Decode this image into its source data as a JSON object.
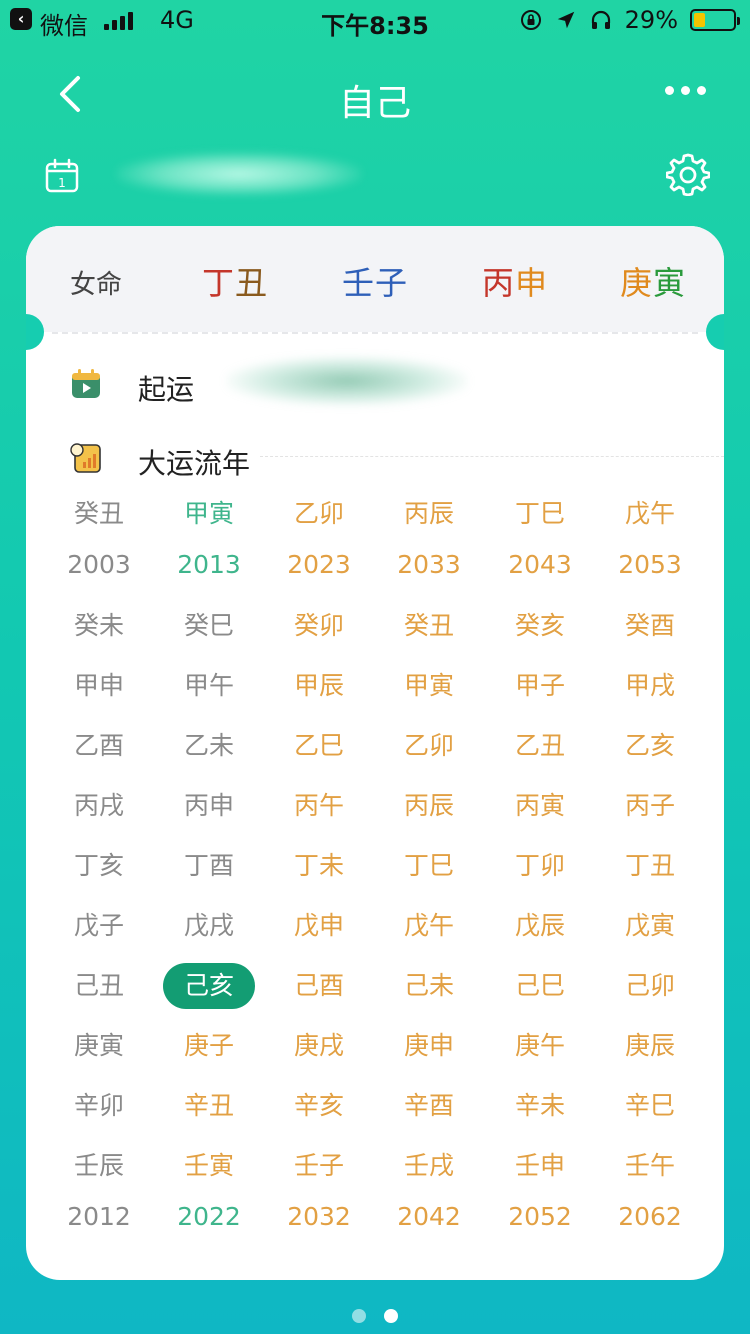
{
  "status_bar": {
    "app": "微信",
    "network": "4G",
    "time": "下午8:35",
    "battery": "29%",
    "battery_level": 0.29
  },
  "nav": {
    "title": "自己"
  },
  "header": {
    "gender": "女命",
    "pillars": [
      {
        "stem": "丁",
        "branch": "丑",
        "stem_color": "#c4362b",
        "branch_color": "#8a5a1e"
      },
      {
        "stem": "壬",
        "branch": "子",
        "stem_color": "#2e5fb8",
        "branch_color": "#2e5fb8"
      },
      {
        "stem": "丙",
        "branch": "申",
        "stem_color": "#c4362b",
        "branch_color": "#e08a1e"
      },
      {
        "stem": "庚",
        "branch": "寅",
        "stem_color": "#e08a1e",
        "branch_color": "#2a9a3c"
      }
    ]
  },
  "sections": {
    "qiyun_label": "起运",
    "dayun_label": "大运流年"
  },
  "dayun": {
    "columns": [
      {
        "pillar": "癸丑",
        "start_year": "2003",
        "end_year": "2012",
        "tone": "gray",
        "liunian": [
          {
            "text": "癸未",
            "tone": "gray"
          },
          {
            "text": "甲申",
            "tone": "gray"
          },
          {
            "text": "乙酉",
            "tone": "gray"
          },
          {
            "text": "丙戌",
            "tone": "gray"
          },
          {
            "text": "丁亥",
            "tone": "gray"
          },
          {
            "text": "戊子",
            "tone": "gray"
          },
          {
            "text": "己丑",
            "tone": "gray"
          },
          {
            "text": "庚寅",
            "tone": "gray"
          },
          {
            "text": "辛卯",
            "tone": "gray"
          },
          {
            "text": "壬辰",
            "tone": "gray"
          }
        ]
      },
      {
        "pillar": "甲寅",
        "start_year": "2013",
        "end_year": "2022",
        "tone": "green",
        "liunian": [
          {
            "text": "癸巳",
            "tone": "gray"
          },
          {
            "text": "甲午",
            "tone": "gray"
          },
          {
            "text": "乙未",
            "tone": "gray"
          },
          {
            "text": "丙申",
            "tone": "gray"
          },
          {
            "text": "丁酉",
            "tone": "gray"
          },
          {
            "text": "戊戌",
            "tone": "gray"
          },
          {
            "text": "己亥",
            "tone": "selected"
          },
          {
            "text": "庚子",
            "tone": "orange"
          },
          {
            "text": "辛丑",
            "tone": "orange"
          },
          {
            "text": "壬寅",
            "tone": "orange"
          }
        ]
      },
      {
        "pillar": "乙卯",
        "start_year": "2023",
        "end_year": "2032",
        "tone": "orange",
        "liunian": [
          {
            "text": "癸卯",
            "tone": "orange"
          },
          {
            "text": "甲辰",
            "tone": "orange"
          },
          {
            "text": "乙巳",
            "tone": "orange"
          },
          {
            "text": "丙午",
            "tone": "orange"
          },
          {
            "text": "丁未",
            "tone": "orange"
          },
          {
            "text": "戊申",
            "tone": "orange"
          },
          {
            "text": "己酉",
            "tone": "orange"
          },
          {
            "text": "庚戌",
            "tone": "orange"
          },
          {
            "text": "辛亥",
            "tone": "orange"
          },
          {
            "text": "壬子",
            "tone": "orange"
          }
        ]
      },
      {
        "pillar": "丙辰",
        "start_year": "2033",
        "end_year": "2042",
        "tone": "orange",
        "liunian": [
          {
            "text": "癸丑",
            "tone": "orange"
          },
          {
            "text": "甲寅",
            "tone": "orange"
          },
          {
            "text": "乙卯",
            "tone": "orange"
          },
          {
            "text": "丙辰",
            "tone": "orange"
          },
          {
            "text": "丁巳",
            "tone": "orange"
          },
          {
            "text": "戊午",
            "tone": "orange"
          },
          {
            "text": "己未",
            "tone": "orange"
          },
          {
            "text": "庚申",
            "tone": "orange"
          },
          {
            "text": "辛酉",
            "tone": "orange"
          },
          {
            "text": "壬戌",
            "tone": "orange"
          }
        ]
      },
      {
        "pillar": "丁巳",
        "start_year": "2043",
        "end_year": "2052",
        "tone": "orange",
        "liunian": [
          {
            "text": "癸亥",
            "tone": "orange"
          },
          {
            "text": "甲子",
            "tone": "orange"
          },
          {
            "text": "乙丑",
            "tone": "orange"
          },
          {
            "text": "丙寅",
            "tone": "orange"
          },
          {
            "text": "丁卯",
            "tone": "orange"
          },
          {
            "text": "戊辰",
            "tone": "orange"
          },
          {
            "text": "己巳",
            "tone": "orange"
          },
          {
            "text": "庚午",
            "tone": "orange"
          },
          {
            "text": "辛未",
            "tone": "orange"
          },
          {
            "text": "壬申",
            "tone": "orange"
          }
        ]
      },
      {
        "pillar": "戊午",
        "start_year": "2053",
        "end_year": "2062",
        "tone": "orange",
        "liunian": [
          {
            "text": "癸酉",
            "tone": "orange"
          },
          {
            "text": "甲戌",
            "tone": "orange"
          },
          {
            "text": "乙亥",
            "tone": "orange"
          },
          {
            "text": "丙子",
            "tone": "orange"
          },
          {
            "text": "丁丑",
            "tone": "orange"
          },
          {
            "text": "戊寅",
            "tone": "orange"
          },
          {
            "text": "己卯",
            "tone": "orange"
          },
          {
            "text": "庚辰",
            "tone": "orange"
          },
          {
            "text": "辛巳",
            "tone": "orange"
          },
          {
            "text": "壬午",
            "tone": "orange"
          }
        ]
      }
    ]
  },
  "pager": {
    "count": 2,
    "active": 1
  }
}
